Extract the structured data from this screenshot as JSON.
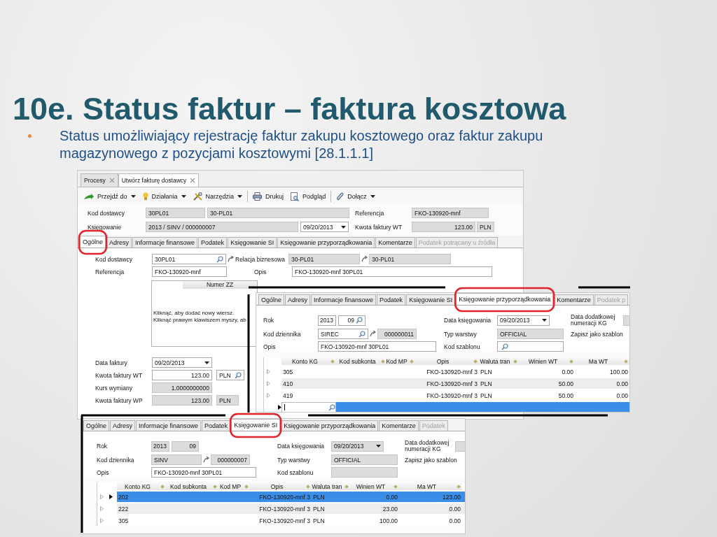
{
  "slide": {
    "title": "10e. Status faktur – faktura kosztowa",
    "bullets": [
      "Status umożliwiający rejestrację faktur zakupu kosztowego oraz faktur zakupu magazynowego z pozycjami kosztowymi [28.1.1.1]"
    ]
  },
  "main_window": {
    "doc_tabs": [
      {
        "label": "Procesy",
        "selected": false
      },
      {
        "label": "Utwórz fakturę dostawcy",
        "selected": true
      }
    ],
    "toolbar_groups": [
      [
        {
          "label": "Przejdź do",
          "menu": true
        },
        {
          "label": "Działania",
          "menu": true
        },
        {
          "label": "Narzędzia",
          "menu": true
        }
      ],
      [
        {
          "label": "Drukuj",
          "menu": false
        },
        {
          "label": "Podgląd",
          "menu": false
        }
      ],
      [
        {
          "label": "Dołącz",
          "menu": true
        }
      ]
    ],
    "header": {
      "supplier_label": "Kod dostawcy",
      "supplier_code": {
        "kind": "text",
        "value": "30PL01",
        "readonly": true
      },
      "supplier_name": {
        "kind": "text",
        "value": "30-PL01",
        "readonly": true
      },
      "reference_label": "Referencja",
      "reference": {
        "kind": "text",
        "value": "FKO-130920-mnf",
        "readonly": true
      },
      "posting_label": "Księgowanie",
      "posting": {
        "kind": "text",
        "value": "2013 / SINV / 000000007",
        "readonly": true
      },
      "posting_date": {
        "kind": "combo",
        "value": "09/20/2013",
        "readonly": false
      },
      "amount_label": "Kwota faktury WT",
      "amount": {
        "kind": "text",
        "value": "123.00",
        "readonly": true
      },
      "currency": {
        "kind": "text",
        "value": "PLN",
        "readonly": true
      }
    },
    "tabs": [
      {
        "label": "Ogólne",
        "selected": true,
        "disabled": false
      },
      {
        "label": "Adresy",
        "selected": false,
        "disabled": false
      },
      {
        "label": "Informacje finansowe",
        "selected": false,
        "disabled": false
      },
      {
        "label": "Podatek",
        "selected": false,
        "disabled": false
      },
      {
        "label": "Księgowanie SI",
        "selected": false,
        "disabled": false
      },
      {
        "label": "Księgowanie przyporządkowania",
        "selected": false,
        "disabled": false
      },
      {
        "label": "Komentarze",
        "selected": false,
        "disabled": false
      },
      {
        "label": "Podatek potrącany u źródła",
        "selected": false,
        "disabled": true
      }
    ],
    "general": {
      "supplier_label": "Kod dostawcy",
      "supplier": {
        "kind": "lookup",
        "value": "30PL01",
        "readonly": false
      },
      "relation_label": "Relacja biznesowa",
      "relation_code": {
        "kind": "text",
        "value": "30-PL01",
        "readonly": true
      },
      "relation_name": {
        "kind": "text",
        "value": "30-PL01",
        "readonly": true
      },
      "reference_label": "Referencja",
      "reference": {
        "kind": "text",
        "value": "FKO-130920-mnf",
        "readonly": false
      },
      "description_label": "Opis",
      "description": {
        "kind": "text",
        "value": "FKO-130920-mnf 30PL01",
        "readonly": false
      },
      "zz_grid": {
        "column": "Numer ZZ",
        "hint_lines": [
          "Kliknąć, aby dodać nowy wiersz.",
          "Kliknąć prawym klawiszem myszy, ab"
        ]
      },
      "invoice_date_label": "Data faktury",
      "invoice_date": {
        "kind": "combo",
        "value": "09/20/2013",
        "readonly": false
      },
      "amount_label": "Kwota faktury WT",
      "amount": {
        "kind": "text",
        "value": "123.00",
        "readonly": false
      },
      "currency": {
        "kind": "lookup",
        "value": "PLN",
        "readonly": false
      },
      "rate_label": "Kurs wymiany",
      "rate": {
        "kind": "text",
        "value": "1.0000000000",
        "readonly": true
      },
      "amount_base_label": "Kwota faktury WP",
      "amount_base": {
        "kind": "text",
        "value": "123.00",
        "readonly": true
      },
      "currency_base": {
        "kind": "text",
        "value": "PLN",
        "readonly": true
      }
    }
  },
  "allocation_window": {
    "tabs": [
      {
        "label": "Ogólne",
        "selected": false,
        "disabled": false
      },
      {
        "label": "Adresy",
        "selected": false,
        "disabled": false
      },
      {
        "label": "Informacje finansowe",
        "selected": false,
        "disabled": false
      },
      {
        "label": "Podatek",
        "selected": false,
        "disabled": false
      },
      {
        "label": "Księgowanie SI",
        "selected": false,
        "disabled": false
      },
      {
        "label": "Księgowanie przyporządkowania",
        "selected": true,
        "disabled": false
      },
      {
        "label": "Komentarze",
        "selected": false,
        "disabled": false
      },
      {
        "label": "Podatek p",
        "selected": false,
        "disabled": true
      }
    ],
    "year_label": "Rok",
    "year": {
      "kind": "text",
      "value": "2013",
      "readonly": false
    },
    "period": {
      "kind": "lookup",
      "value": "09",
      "readonly": false
    },
    "journal_label": "Kod dziennika",
    "journal": {
      "kind": "lookup",
      "value": "SIREC",
      "readonly": false
    },
    "number": {
      "kind": "text",
      "value": "000000011",
      "readonly": true
    },
    "description_label": "Opis",
    "description": {
      "kind": "text",
      "value": "FKO-130920-mnf 30PL01",
      "readonly": false
    },
    "date_label": "Data księgowania",
    "date": {
      "kind": "combo",
      "value": "09/20/2013",
      "readonly": false
    },
    "layer_label": "Typ warstwy",
    "layer": {
      "kind": "text",
      "value": "OFFICIAL",
      "readonly": true
    },
    "template_label": "Kod szablonu",
    "template": {
      "kind": "lookup",
      "readonly": false
    },
    "extra_label": "Data dodatkowej numeracji KG",
    "extra": {
      "kind": "text",
      "readonly": true
    },
    "save_template_label": "Zapisz jako szablon",
    "grid": {
      "columns": [
        "Konto KG",
        "Kod subkonta",
        "Kod MP",
        "Opis",
        "Waluta tran",
        "Winien WT",
        "Ma WT"
      ],
      "rows": [
        {
          "kind": "entry",
          "account": "305",
          "description": "FKO-130920-mnf 3",
          "currency": "PLN",
          "debit": "0.00",
          "credit": "100.00",
          "selected": false,
          "current": false
        },
        {
          "kind": "entry",
          "account": "410",
          "description": "FKO-130920-mnf 3",
          "currency": "PLN",
          "debit": "50.00",
          "credit": "0.00",
          "selected": false,
          "current": false
        },
        {
          "kind": "entry",
          "account": "419",
          "description": "FKO-130920-mnf 3",
          "currency": "PLN",
          "debit": "50.00",
          "credit": "0.00",
          "selected": false,
          "current": false
        },
        {
          "kind": "new",
          "selected": true,
          "current": true
        }
      ]
    }
  },
  "posting_window": {
    "tabs": [
      {
        "label": "Ogólne",
        "selected": false,
        "disabled": false
      },
      {
        "label": "Adresy",
        "selected": false,
        "disabled": false
      },
      {
        "label": "Informacje finansowe",
        "selected": false,
        "disabled": false
      },
      {
        "label": "Podatek",
        "selected": false,
        "disabled": false
      },
      {
        "label": "Księgowanie SI",
        "selected": true,
        "disabled": false
      },
      {
        "label": "Księgowanie przyporządkowania",
        "selected": false,
        "disabled": false
      },
      {
        "label": "Komentarze",
        "selected": false,
        "disabled": false
      },
      {
        "label": "Podatek",
        "selected": false,
        "disabled": true
      }
    ],
    "year_label": "Rok",
    "year": {
      "kind": "text",
      "value": "2013",
      "readonly": true
    },
    "period": {
      "kind": "text",
      "value": "09",
      "readonly": true
    },
    "journal_label": "Kod dziennika",
    "journal": {
      "kind": "text",
      "value": "SINV",
      "readonly": true
    },
    "number": {
      "kind": "text",
      "value": "000000007",
      "readonly": true
    },
    "description_label": "Opis",
    "description": {
      "kind": "text",
      "value": "FKO-130920-mnf 30PL01",
      "readonly": false
    },
    "date_label": "Data księgowania",
    "date": {
      "kind": "combo",
      "value": "09/20/2013",
      "readonly": true
    },
    "layer_label": "Typ warstwy",
    "layer": {
      "kind": "text",
      "value": "OFFICIAL",
      "readonly": true
    },
    "template_label": "Kod szablonu",
    "template": {
      "kind": "text",
      "readonly": true
    },
    "extra_label": "Data dodatkowej numeracji KG",
    "extra": {
      "kind": "text",
      "readonly": true
    },
    "save_template_label": "Zapisz jako szablon",
    "grid": {
      "columns": [
        "Konto KG",
        "Kod subkonta",
        "Kod MP",
        "Opis",
        "Waluta tran",
        "Winien WT",
        "Ma WT"
      ],
      "rows": [
        {
          "kind": "entry",
          "account": "202",
          "description": "FKO-130920-mnf 3",
          "currency": "PLN",
          "debit": "0.00",
          "credit": "123.00",
          "selected": true,
          "current": true
        },
        {
          "kind": "entry",
          "account": "222",
          "description": "FKO-130920-mnf 3",
          "currency": "PLN",
          "debit": "23.00",
          "credit": "0.00",
          "selected": false,
          "current": false
        },
        {
          "kind": "entry",
          "account": "305",
          "description": "FKO-130920-mnf 3",
          "currency": "PLN",
          "debit": "100.00",
          "credit": "0.00",
          "selected": false,
          "current": false
        }
      ]
    }
  }
}
